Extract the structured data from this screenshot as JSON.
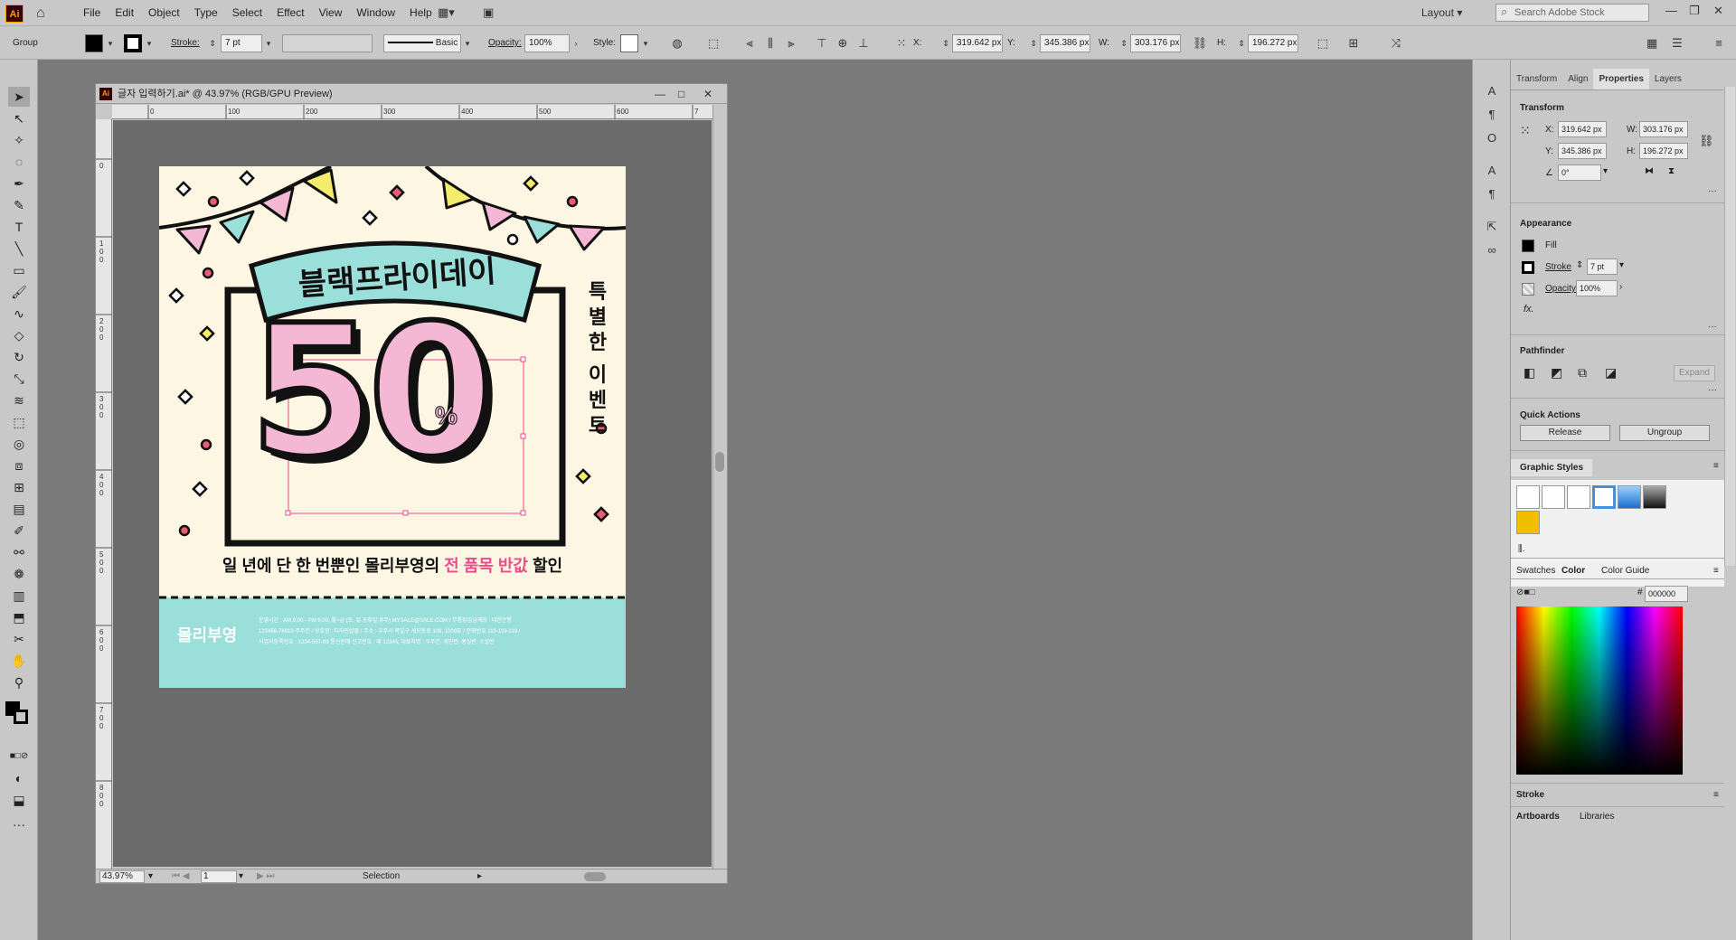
{
  "app": {
    "logo": "Ai",
    "menus": [
      "File",
      "Edit",
      "Object",
      "Type",
      "Select",
      "Effect",
      "View",
      "Window",
      "Help"
    ],
    "workspace": "Layout",
    "search_placeholder": "Search Adobe Stock"
  },
  "control": {
    "selection": "Group",
    "stroke_label": "Stroke:",
    "stroke_value": "7 pt",
    "brush": "Basic",
    "opacity_label": "Opacity:",
    "opacity_value": "100%",
    "style_label": "Style:",
    "x_label": "X:",
    "x": "319.642 px",
    "y_label": "Y:",
    "y": "345.386 px",
    "w_label": "W:",
    "w": "303.176 px",
    "h_label": "H:",
    "h": "196.272 px"
  },
  "doc": {
    "title": "글자 입력하기.ai* @ 43.97% (RGB/GPU Preview)",
    "zoom": "43.97%",
    "artboard": "1",
    "tool": "Selection"
  },
  "ruler": {
    "h": [
      "0",
      "100",
      "200",
      "300",
      "400",
      "500",
      "600",
      "7"
    ],
    "v": [
      "0",
      "1\n0\n0",
      "2\n0\n0",
      "3\n0\n0",
      "4\n0\n0",
      "5\n0\n0",
      "6\n0\n0",
      "7\n0\n0",
      "8\n0\n0"
    ]
  },
  "poster": {
    "title": "블랙프라이데이",
    "big": "50",
    "percent": "%",
    "side": [
      "특",
      "별",
      "한",
      "이",
      "벤",
      "트"
    ],
    "sub_a": "일 년에 단 한 번뿐인 몰리부영의 ",
    "sub_b": "전 품목 반값",
    "sub_c": " 할인",
    "brand": "몰리부영",
    "info1": "운영시간 : AM 9:00 - PM 6:00, 월~금 (토, 일 공휴일 휴무) MYSALE@SALE.COM / 무통장입금계좌 : 대한은행",
    "info2": "123456-78910 주주킨 / 상호명 : 디자인샵몰 / 주소 : 우주시 북일구 세모동로 108, 1009호 / 전화번호 119-119-119 /",
    "info3": "사업자등록번호 : 1234-567-89 통신판매 신고번호 : 제 12345, 대표자명 : 우주킨, 개인번, 홍실번, 소셜번",
    "colors": {
      "cream": "#fdf6e3",
      "mint": "#9adfd9",
      "pink": "#f5b8d4",
      "yellow": "#f5ec6e",
      "red": "#e85c75",
      "accent_text": "#e84c8a"
    }
  },
  "panel": {
    "tabs": [
      "Transform",
      "Align",
      "Properties",
      "Layers"
    ],
    "transform": "Transform",
    "x_label": "X:",
    "x": "319.642 px",
    "w_label": "W:",
    "w": "303.176 px",
    "y_label": "Y:",
    "y": "345.386 px",
    "h_label": "H:",
    "h": "196.272 px",
    "angle": "0°",
    "appearance": "Appearance",
    "fill": "Fill",
    "stroke": "Stroke",
    "stroke_val": "7 pt",
    "opacity": "Opacity",
    "opacity_val": "100%",
    "fx": "fx.",
    "pathfinder": "Pathfinder",
    "expand": "Expand",
    "quick": "Quick Actions",
    "release": "Release",
    "ungroup": "Ungroup",
    "graphic_styles": "Graphic Styles",
    "swatches": "Swatches",
    "color": "Color",
    "color_guide": "Color Guide",
    "hex": "000000",
    "stroke_panel": "Stroke",
    "artboards": "Artboards",
    "libraries": "Libraries"
  }
}
